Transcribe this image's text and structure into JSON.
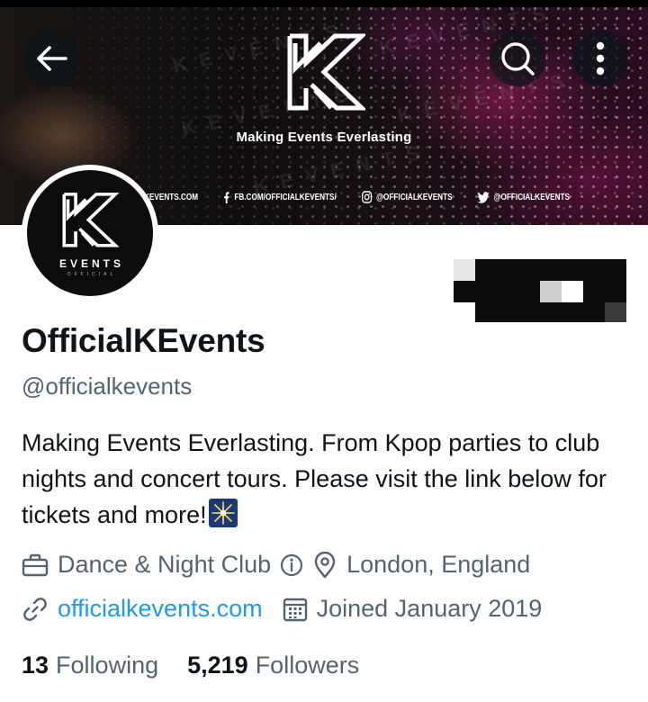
{
  "banner": {
    "tagline": "Making Events Everlasting",
    "watermark_text": "KEVENTS",
    "social": [
      {
        "icon": "globe-icon",
        "label": "KEVENTS.COM"
      },
      {
        "icon": "facebook-icon",
        "label": "FB.COM/OFFICIALKEVENTS/"
      },
      {
        "icon": "instagram-icon",
        "label": "@OFFICIALKEVENTS"
      },
      {
        "icon": "twitter-icon",
        "label": "@OFFICIALKEVENTS"
      }
    ]
  },
  "avatar": {
    "logo_letter": "K",
    "label": "EVENTS",
    "sublabel": "OFFICIAL"
  },
  "profile": {
    "display_name": "OfficialKEvents",
    "handle": "@officialkevents",
    "bio": "Making Events Everlasting. From Kpop parties to club nights and concert tours. Please visit the link below for tickets and more!",
    "bio_emoji": "sparkler-emoji",
    "category": "Dance & Night Club",
    "location": "London, England",
    "website": "officialkevents.com",
    "joined": "Joined January 2019",
    "following_count": "13",
    "following_label": "Following",
    "followers_count": "5,219",
    "followers_label": "Followers"
  },
  "colors": {
    "text_primary": "#0f1419",
    "text_secondary": "#536471",
    "link": "#1d9bf0",
    "banner_button_bg": "#0f1419"
  }
}
